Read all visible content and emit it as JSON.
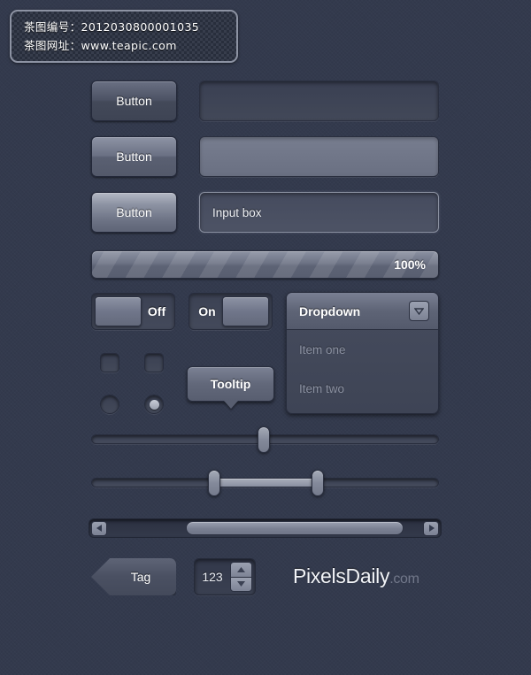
{
  "watermark": {
    "line1": "茶图编号：2012030800001035",
    "line2": "茶图网址：www.teapic.com"
  },
  "buttons": {
    "normal_label": "Button",
    "hover_label": "Button",
    "active_label": "Button"
  },
  "inputs": {
    "empty_placeholder": "",
    "filled_placeholder": "",
    "text_value": "Input box"
  },
  "progress": {
    "label": "100%",
    "percent": 100
  },
  "toggles": {
    "off": {
      "label": "Off",
      "state": "off"
    },
    "on": {
      "label": "On",
      "state": "on"
    }
  },
  "dropdown": {
    "title": "Dropdown",
    "items": [
      {
        "label": "Item one"
      },
      {
        "label": "Item two"
      }
    ]
  },
  "tooltip": {
    "label": "Tooltip"
  },
  "tag": {
    "label": "Tag"
  },
  "stepper": {
    "value": "123"
  },
  "brand": {
    "name": "PixelsDaily",
    "tld": ".com"
  },
  "colors": {
    "background": "#333a4d",
    "control_light": "#8d93a3",
    "control_dark": "#3e4454",
    "text_primary": "#ffffff",
    "text_muted": "#8b91a1"
  }
}
